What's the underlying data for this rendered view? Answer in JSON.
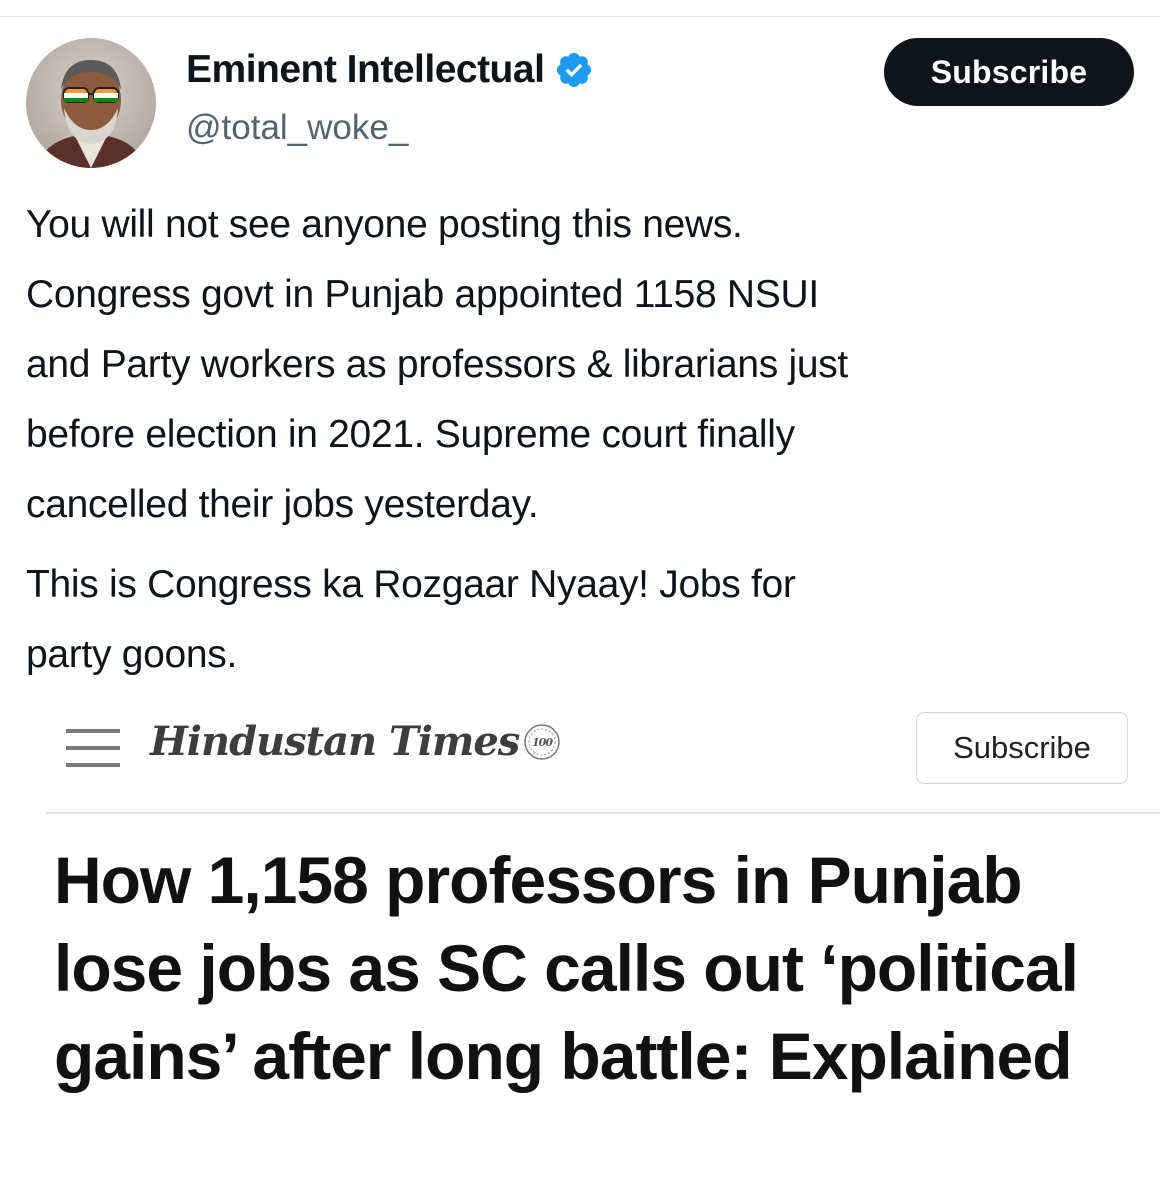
{
  "tweet": {
    "author": {
      "display_name": "Eminent Intellectual",
      "handle": "@total_woke_",
      "verified_icon": "verified-badge-icon"
    },
    "subscribe_label": "Subscribe",
    "paragraphs": [
      "You will not see anyone posting this news.\nCongress govt in Punjab appointed 1158 NSUI\nand Party workers as professors & librarians just\nbefore election in 2021. Supreme court finally\ncancelled their jobs yesterday.",
      "This is Congress ka Rozgaar Nyaay! Jobs for\nparty goons."
    ]
  },
  "embedded_article": {
    "publisher_logo": "Hindustan Times",
    "logo_badge": "100",
    "subscribe_label": "Subscribe",
    "menu_icon": "hamburger-menu-icon",
    "headline": "How 1,158 professors in Punjab lose jobs as SC calls out ‘political gains’ after long battle: Explained"
  },
  "colors": {
    "text": "#0f1419",
    "secondary_text": "#536471",
    "verified_blue": "#1d9bf0",
    "button_dark": "#0f1419"
  }
}
